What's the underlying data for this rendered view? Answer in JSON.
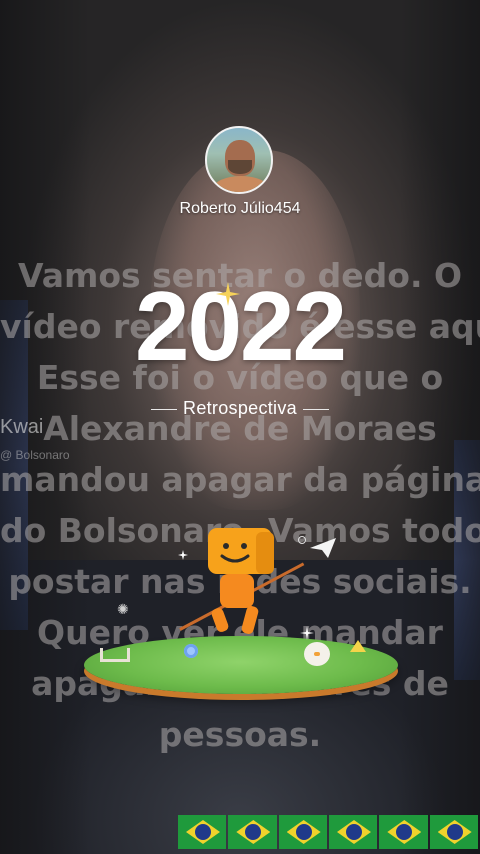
{
  "profile": {
    "username": "Roberto Júlio454",
    "avatar_icon": "user-avatar"
  },
  "retrospective": {
    "year": "2022",
    "label": "Retrospectiva"
  },
  "background_caption": {
    "text": "Vamos sentar o dedo. O\nvídeo removido é esse aqui.\nEsse foi o vídeo que o\nAlexandre de Moraes\nmandou apagar da página\ndo Bolsonaro. Vamos todos\npostar nas redes sociais.\nQuero ver ele mandar\napagar de milhares de\npessoas."
  },
  "watermark": {
    "app": "Kwai",
    "handle": "@ Bolsonaro"
  },
  "decor": {
    "mascot_icon": "kwai-mascot-icon",
    "sparkle_icon": "sparkle-icon",
    "paper_plane_icon": "paper-plane-icon",
    "flag_icon": "brazil-flag-icon",
    "flag_count": 6
  },
  "colors": {
    "text": "#ffffff",
    "grass": "#6dbb4b",
    "mascot": "#f5a623"
  }
}
